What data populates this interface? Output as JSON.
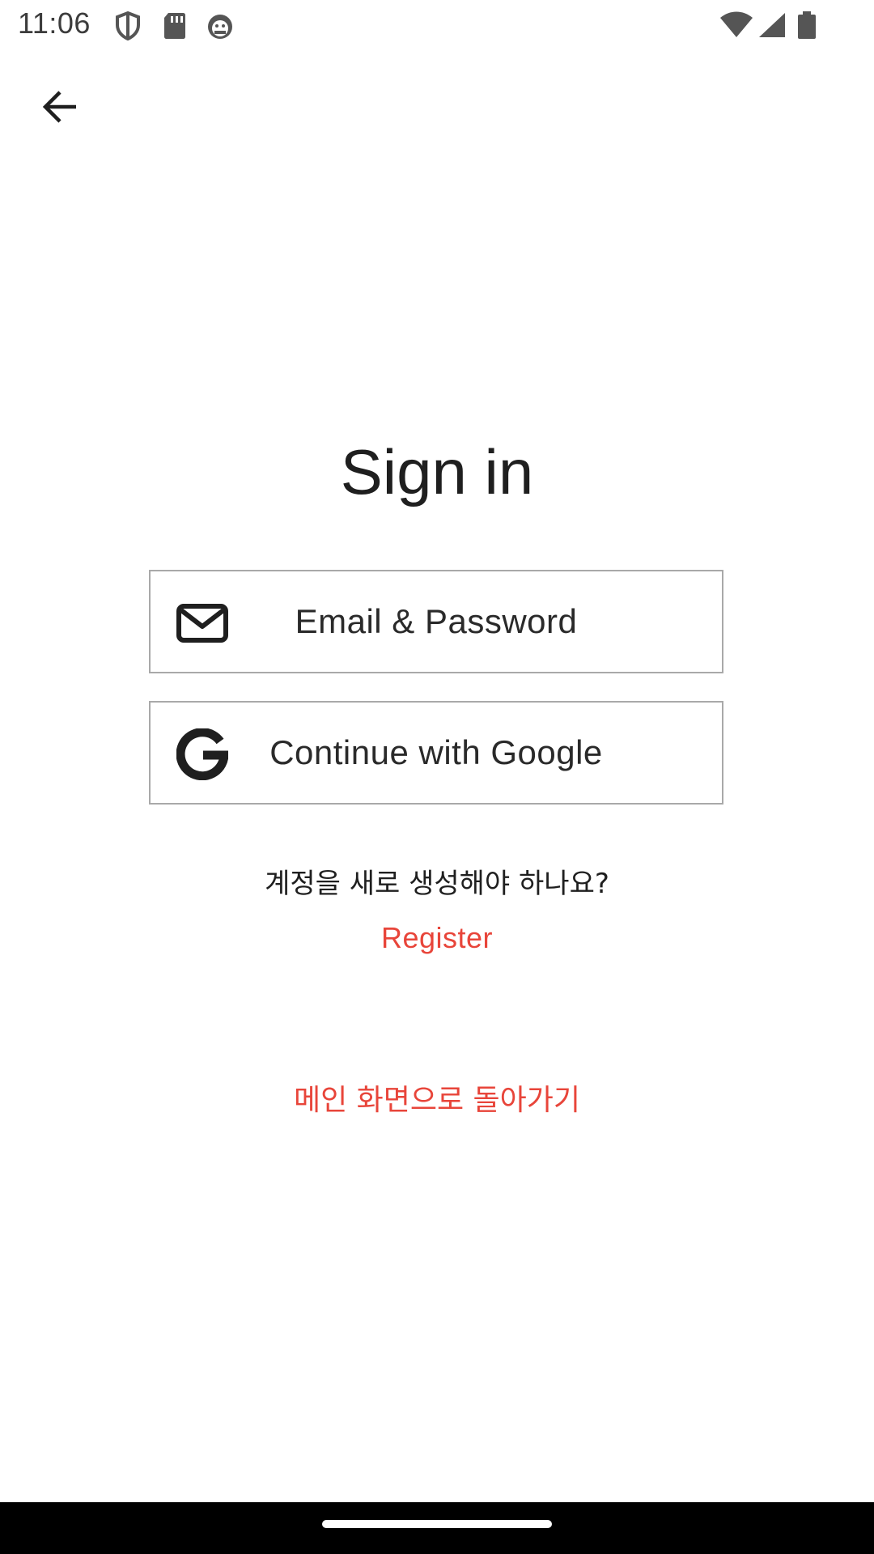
{
  "status_bar": {
    "time": "11:06",
    "icons": [
      "shield-icon",
      "sd-card-icon",
      "android-debug-icon",
      "wifi-icon",
      "cell-signal-icon",
      "battery-icon"
    ]
  },
  "nav": {
    "back_icon": "arrow-left-icon"
  },
  "auth": {
    "title": "Sign in",
    "providers": [
      {
        "label": "Email & Password",
        "icon": "envelope-icon"
      },
      {
        "label": "Continue with Google",
        "icon": "google-icon"
      }
    ],
    "new_account_prompt": "계정을 새로 생성해야 하나요?",
    "register_label": "Register",
    "back_home_label": "메인 화면으로 돌아가기"
  },
  "colors": {
    "accent": "#e8453a",
    "text": "#1f1f1f",
    "button_border": "#a9a9a9"
  }
}
